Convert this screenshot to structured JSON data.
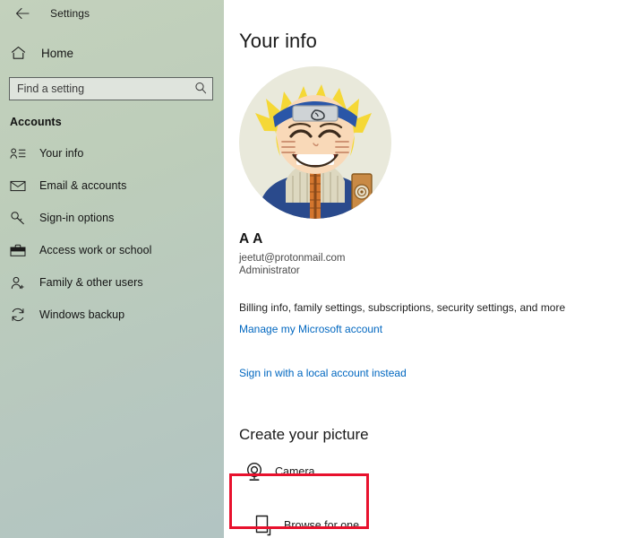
{
  "titlebar": {
    "back_icon": "back-arrow-icon",
    "title": "Settings"
  },
  "sidebar": {
    "home": {
      "label": "Home",
      "icon": "home-icon"
    },
    "search": {
      "placeholder": "Find a setting",
      "value": "",
      "icon": "search-icon"
    },
    "section_header": "Accounts",
    "items": [
      {
        "label": "Your info",
        "icon": "contact-card-icon"
      },
      {
        "label": "Email & accounts",
        "icon": "envelope-icon"
      },
      {
        "label": "Sign-in options",
        "icon": "key-icon"
      },
      {
        "label": "Access work or school",
        "icon": "briefcase-icon"
      },
      {
        "label": "Family & other users",
        "icon": "person-add-icon"
      },
      {
        "label": "Windows backup",
        "icon": "sync-icon"
      }
    ]
  },
  "main": {
    "page_title": "Your info",
    "avatar": {
      "alt": "user-profile-picture"
    },
    "account": {
      "name": "A A",
      "email": "jeetut@protonmail.com",
      "role": "Administrator"
    },
    "billing_text": "Billing info, family settings, subscriptions, security settings, and more",
    "manage_link": "Manage my Microsoft account",
    "local_account_link": "Sign in with a local account instead",
    "create_picture": {
      "title": "Create your picture",
      "options": [
        {
          "label": "Camera",
          "icon": "webcam-icon"
        },
        {
          "label": "Browse for one",
          "icon": "document-page-icon"
        }
      ]
    }
  },
  "colors": {
    "sidebar_top": "#c3d1bc",
    "sidebar_bottom": "#b2c4c2",
    "link": "#0067c0",
    "highlight": "#e8112d",
    "text": "#1a1a1a"
  }
}
